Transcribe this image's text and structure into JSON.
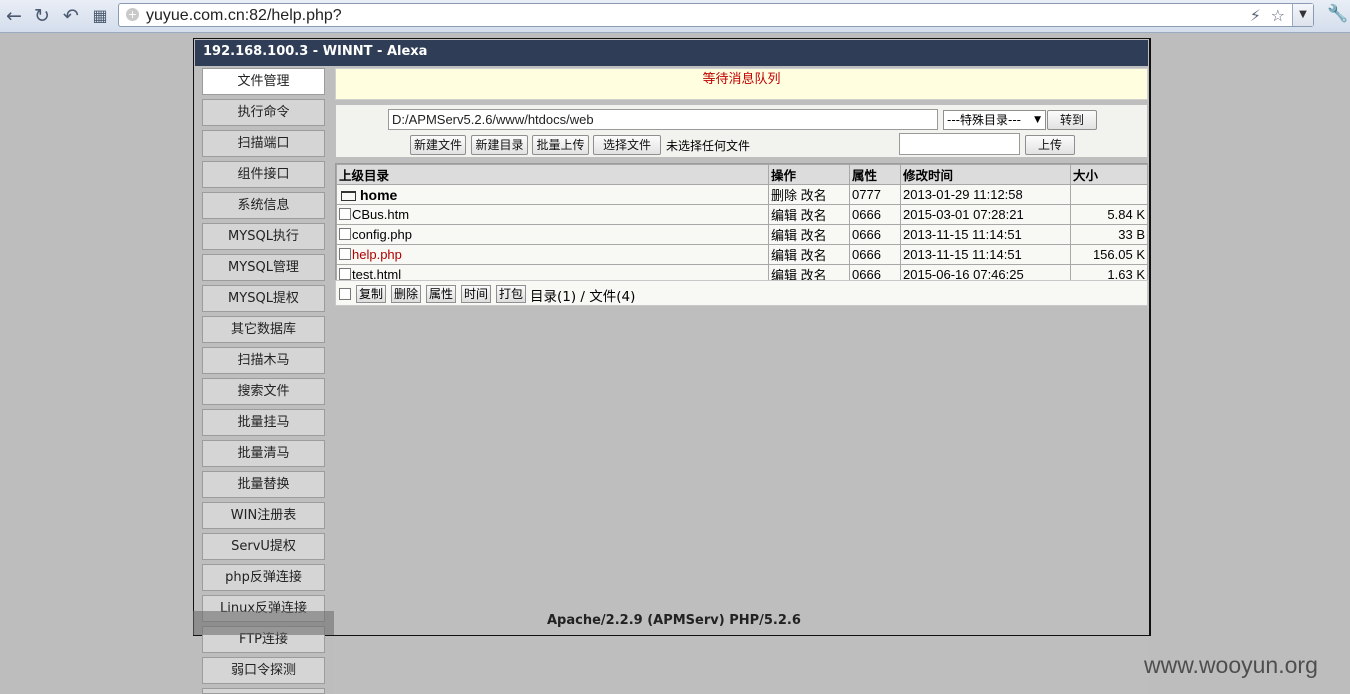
{
  "browser": {
    "url": "yuyue.com.cn:82/help.php?"
  },
  "shell": {
    "title": "192.168.100.3 - WINNT - Alexa",
    "message": "等待消息队列",
    "menu": [
      "文件管理",
      "执行命令",
      "扫描端口",
      "组件接口",
      "系统信息",
      "MYSQL执行",
      "MYSQL管理",
      "MYSQL提权",
      "其它数据库",
      "扫描木马",
      "搜索文件",
      "批量挂马",
      "批量清马",
      "批量替换",
      "WIN注册表",
      "ServU提权",
      "php反弹连接",
      "Linux反弹连接",
      "FTP连接",
      "弱口令探测"
    ],
    "path": "D:/APMServ5.2.6/www/htdocs/web",
    "special_dir": "---特殊目录---",
    "goto_btn": "转到",
    "new_file_btn": "新建文件",
    "new_dir_btn": "新建目录",
    "batch_upload_btn": "批量上传",
    "choose_file_btn": "选择文件",
    "no_file_text": "未选择任何文件",
    "upload_btn": "上传",
    "table_headers": [
      "上级目录",
      "操作",
      "属性",
      "修改时间",
      "大小"
    ],
    "files": [
      {
        "name": "home",
        "ops": "删除 改名",
        "attr": "0777",
        "time": "2013-01-29 11:12:58",
        "size": ""
      },
      {
        "name": "CBus.htm",
        "ops": "编辑 改名",
        "attr": "0666",
        "time": "2015-03-01 07:28:21",
        "size": "5.84 K"
      },
      {
        "name": "config.php",
        "ops": "编辑 改名",
        "attr": "0666",
        "time": "2013-11-15 11:14:51",
        "size": "33 B"
      },
      {
        "name": "help.php",
        "ops": "编辑 改名",
        "attr": "0666",
        "time": "2013-11-15 11:14:51",
        "size": "156.05 K"
      },
      {
        "name": "test.html",
        "ops": "编辑 改名",
        "attr": "0666",
        "time": "2015-06-16 07:46:25",
        "size": "1.63 K"
      }
    ],
    "actions": [
      "复制",
      "删除",
      "属性",
      "时间",
      "打包"
    ],
    "summary": "目录(1) / 文件(4)",
    "server_info": "Apache/2.2.9 (APMServ) PHP/5.2.6"
  },
  "watermark": "www.wooyun.org",
  "colors": {
    "titlebar": "#2f3e56",
    "message": "#c00000",
    "highlight_file": "#b00000"
  }
}
